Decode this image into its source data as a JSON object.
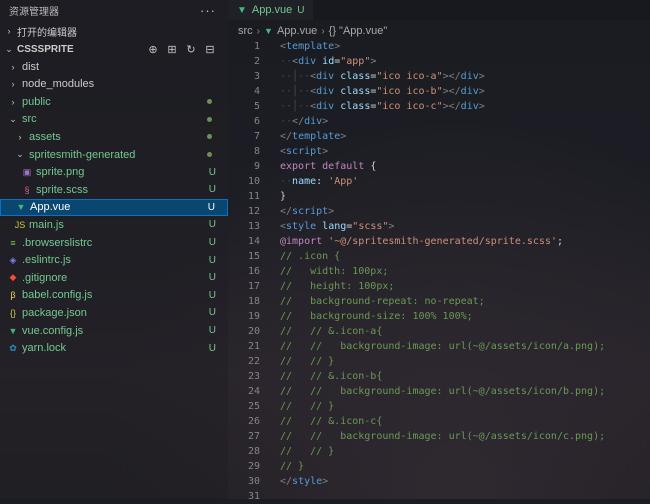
{
  "explorer": {
    "title": "资源管理器",
    "more": "···",
    "open_editors": "打开的编辑器",
    "project": "CSSSPRITE",
    "items": [
      {
        "label": "dist",
        "kind": "folder-closed",
        "indent": 1,
        "color": "#cccccc",
        "status": ""
      },
      {
        "label": "node_modules",
        "kind": "folder-closed",
        "indent": 1,
        "color": "#cccccc",
        "status": ""
      },
      {
        "label": "public",
        "kind": "folder-closed",
        "indent": 1,
        "color": "#73c991",
        "status": "dot"
      },
      {
        "label": "src",
        "kind": "folder-open",
        "indent": 1,
        "color": "#73c991",
        "status": "dot"
      },
      {
        "label": "assets",
        "kind": "folder-closed",
        "indent": 2,
        "color": "#73c991",
        "status": "dot"
      },
      {
        "label": "spritesmith-generated",
        "kind": "folder-open",
        "indent": 2,
        "color": "#73c991",
        "status": "dot"
      },
      {
        "label": "sprite.png",
        "kind": "image",
        "indent": 3,
        "color": "#73c991",
        "status": "U"
      },
      {
        "label": "sprite.scss",
        "kind": "scss",
        "indent": 3,
        "color": "#73c991",
        "status": "U"
      },
      {
        "label": "App.vue",
        "kind": "vue",
        "indent": 2,
        "color": "#73c991",
        "status": "U",
        "selected": true
      },
      {
        "label": "main.js",
        "kind": "js",
        "indent": 2,
        "color": "#73c991",
        "status": "U"
      },
      {
        "label": ".browserslistrc",
        "kind": "list",
        "indent": 1,
        "color": "#73c991",
        "status": "U"
      },
      {
        "label": ".eslintrc.js",
        "kind": "eslint",
        "indent": 1,
        "color": "#73c991",
        "status": "U"
      },
      {
        "label": ".gitignore",
        "kind": "git",
        "indent": 1,
        "color": "#73c991",
        "status": "U"
      },
      {
        "label": "babel.config.js",
        "kind": "babel",
        "indent": 1,
        "color": "#73c991",
        "status": "U"
      },
      {
        "label": "package.json",
        "kind": "json",
        "indent": 1,
        "color": "#73c991",
        "status": "U"
      },
      {
        "label": "vue.config.js",
        "kind": "vue",
        "indent": 1,
        "color": "#73c991",
        "status": "U"
      },
      {
        "label": "yarn.lock",
        "kind": "yarn",
        "indent": 1,
        "color": "#73c991",
        "status": "U"
      }
    ],
    "icons": {
      "folder-closed": "›",
      "folder-open": "⌄",
      "image": "▣",
      "scss": "§",
      "vue": "▼",
      "js": "JS",
      "list": "≡",
      "eslint": "◈",
      "git": "◆",
      "babel": "β",
      "json": "{}",
      "yarn": "✿"
    }
  },
  "editor": {
    "tab": {
      "name": "App.vue",
      "status": "U",
      "close": "×"
    },
    "breadcrumb": [
      "src",
      "App.vue",
      "{} \"App.vue\""
    ]
  },
  "code_lines": [
    [
      [
        "tag",
        "<"
      ],
      [
        "tn",
        "template"
      ],
      [
        "tag",
        ">"
      ]
    ],
    [
      [
        "ws",
        "··"
      ],
      [
        "tag",
        "<"
      ],
      [
        "tn",
        "div"
      ],
      [
        "op",
        " "
      ],
      [
        "at",
        "id"
      ],
      [
        "op",
        "="
      ],
      [
        "st",
        "\"app\""
      ],
      [
        "tag",
        ">"
      ]
    ],
    [
      [
        "ws",
        "··│··"
      ],
      [
        "tag",
        "<"
      ],
      [
        "tn",
        "div"
      ],
      [
        "op",
        " "
      ],
      [
        "at",
        "class"
      ],
      [
        "op",
        "="
      ],
      [
        "st",
        "\"ico ico-a\""
      ],
      [
        "tag",
        "></"
      ],
      [
        "tn",
        "div"
      ],
      [
        "tag",
        ">"
      ]
    ],
    [
      [
        "ws",
        "··│··"
      ],
      [
        "tag",
        "<"
      ],
      [
        "tn",
        "div"
      ],
      [
        "op",
        " "
      ],
      [
        "at",
        "class"
      ],
      [
        "op",
        "="
      ],
      [
        "st",
        "\"ico ico-b\""
      ],
      [
        "tag",
        "></"
      ],
      [
        "tn",
        "div"
      ],
      [
        "tag",
        ">"
      ]
    ],
    [
      [
        "ws",
        "··│··"
      ],
      [
        "tag",
        "<"
      ],
      [
        "tn",
        "div"
      ],
      [
        "op",
        " "
      ],
      [
        "at",
        "class"
      ],
      [
        "op",
        "="
      ],
      [
        "st",
        "\"ico ico-c\""
      ],
      [
        "tag",
        "></"
      ],
      [
        "tn",
        "div"
      ],
      [
        "tag",
        ">"
      ]
    ],
    [
      [
        "ws",
        "··"
      ],
      [
        "tag",
        "</"
      ],
      [
        "tn",
        "div"
      ],
      [
        "tag",
        ">"
      ]
    ],
    [
      [
        "tag",
        "</"
      ],
      [
        "tn",
        "template"
      ],
      [
        "tag",
        ">"
      ]
    ],
    [
      [
        "tag",
        "<"
      ],
      [
        "tn",
        "script"
      ],
      [
        "tag",
        ">"
      ]
    ],
    [
      [
        "kw",
        "export"
      ],
      [
        "op",
        " "
      ],
      [
        "kw",
        "default"
      ],
      [
        "op",
        " "
      ],
      [
        "pn",
        "{"
      ]
    ],
    [
      [
        "ws",
        "··"
      ],
      [
        "at",
        "name"
      ],
      [
        "op",
        ": "
      ],
      [
        "st",
        "'App'"
      ]
    ],
    [
      [
        "pn",
        "}"
      ]
    ],
    [
      [
        "tag",
        "</"
      ],
      [
        "tn",
        "script"
      ],
      [
        "tag",
        ">"
      ]
    ],
    [
      [
        "tag",
        "<"
      ],
      [
        "tn",
        "style"
      ],
      [
        "op",
        " "
      ],
      [
        "at",
        "lang"
      ],
      [
        "op",
        "="
      ],
      [
        "st",
        "\"scss\""
      ],
      [
        "tag",
        ">"
      ]
    ],
    [
      [
        "kw",
        "@import"
      ],
      [
        "op",
        " "
      ],
      [
        "st",
        "'~@/spritesmith-generated/sprite.scss'"
      ],
      [
        "op",
        ";"
      ]
    ],
    [
      [
        "cm",
        "// .icon {"
      ]
    ],
    [
      [
        "cm",
        "//   width: 100px;"
      ]
    ],
    [
      [
        "cm",
        "//   height: 100px;"
      ]
    ],
    [
      [
        "cm",
        "//   background-repeat: no-repeat;"
      ]
    ],
    [
      [
        "cm",
        "//   background-size: 100% 100%;"
      ]
    ],
    [
      [
        "cm",
        "//   // &.icon-a{"
      ]
    ],
    [
      [
        "cm",
        "//   //   background-image: url(~@/assets/icon/a.png);"
      ]
    ],
    [
      [
        "cm",
        "//   // }"
      ]
    ],
    [
      [
        "cm",
        "//   // &.icon-b{"
      ]
    ],
    [
      [
        "cm",
        "//   //   background-image: url(~@/assets/icon/b.png);"
      ]
    ],
    [
      [
        "cm",
        "//   // }"
      ]
    ],
    [
      [
        "cm",
        "//   // &.icon-c{"
      ]
    ],
    [
      [
        "cm",
        "//   //   background-image: url(~@/assets/icon/c.png);"
      ]
    ],
    [
      [
        "cm",
        "//   // }"
      ]
    ],
    [
      [
        "cm",
        "// }"
      ]
    ],
    [
      [
        "tag",
        "</"
      ],
      [
        "tn",
        "style"
      ],
      [
        "tag",
        ">"
      ]
    ],
    [
      [
        "op",
        ""
      ]
    ]
  ],
  "colors": {
    "accent": "#0e70c0",
    "untracked": "#73c991",
    "selection": "#094771"
  }
}
